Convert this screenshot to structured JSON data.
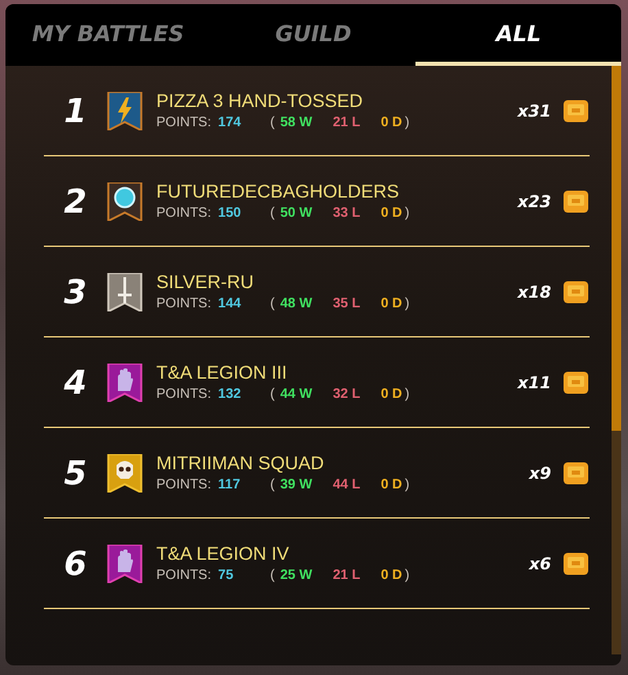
{
  "tabs": [
    {
      "label": "MY BATTLES",
      "selected": false
    },
    {
      "label": "GUILD",
      "selected": false
    },
    {
      "label": "ALL",
      "selected": true
    }
  ],
  "rows": [
    {
      "rank": "1",
      "kind": "lightning",
      "name": "PIZZA 3 HAND-TOSSED",
      "points_label": "POINTS:",
      "points": "174",
      "open": "(",
      "wins": "58 W",
      "losses": "21 L",
      "draws": "0 D",
      "close": ")",
      "multiplier": "x31"
    },
    {
      "rank": "2",
      "kind": "orb",
      "name": "FUTUREDECBAGHOLDERS",
      "points_label": "POINTS:",
      "points": "150",
      "open": "(",
      "wins": "50 W",
      "losses": "33 L",
      "draws": "0 D",
      "close": ")",
      "multiplier": "x23"
    },
    {
      "rank": "3",
      "kind": "sword",
      "name": "SILVER-RU",
      "points_label": "POINTS:",
      "points": "144",
      "open": "(",
      "wins": "48 W",
      "losses": "35 L",
      "draws": "0 D",
      "close": ")",
      "multiplier": "x18"
    },
    {
      "rank": "4",
      "kind": "hand",
      "name": "T&A LEGION III",
      "points_label": "POINTS:",
      "points": "132",
      "open": "(",
      "wins": "44 W",
      "losses": "32 L",
      "draws": "0 D",
      "close": ")",
      "multiplier": "x11"
    },
    {
      "rank": "5",
      "kind": "skull",
      "name": "MITRIIMAN SQUAD",
      "points_label": "POINTS:",
      "points": "117",
      "open": "(",
      "wins": "39 W",
      "losses": "44 L",
      "draws": "0 D",
      "close": ")",
      "multiplier": "x9"
    },
    {
      "rank": "6",
      "kind": "hand",
      "name": "T&A LEGION IV",
      "points_label": "POINTS:",
      "points": "75",
      "open": "(",
      "wins": "25 W",
      "losses": "21 L",
      "draws": "0 D",
      "close": ")",
      "multiplier": "x6"
    }
  ]
}
